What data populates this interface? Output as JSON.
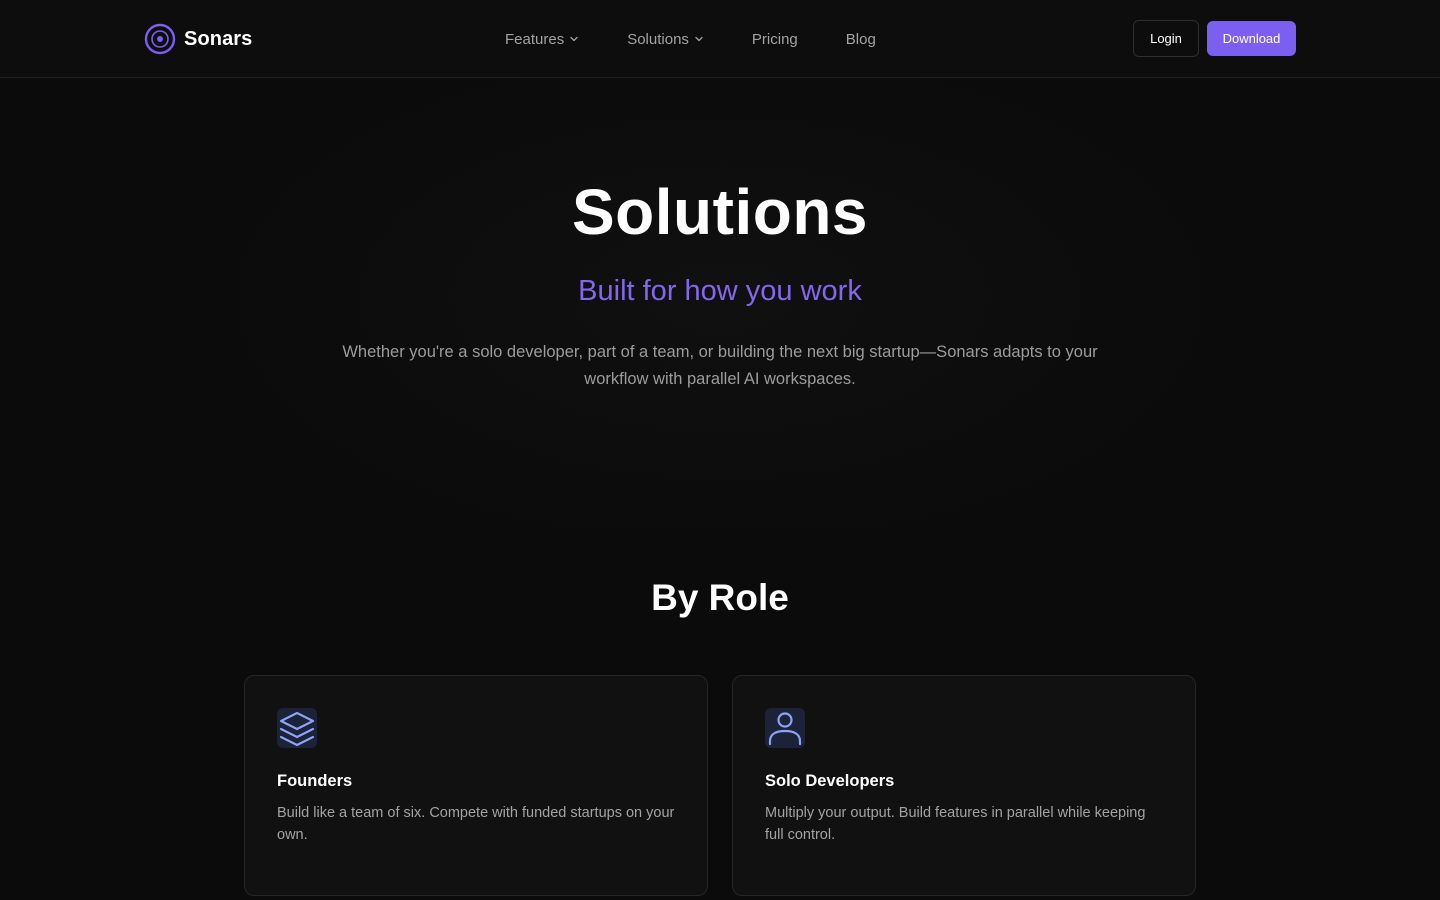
{
  "brand": {
    "name": "Sonars",
    "logo_icon": "sonar-target-icon",
    "accent_color": "#7b5ff0"
  },
  "nav": {
    "items": [
      {
        "label": "Features",
        "has_dropdown": true
      },
      {
        "label": "Solutions",
        "has_dropdown": true
      },
      {
        "label": "Pricing",
        "has_dropdown": false
      },
      {
        "label": "Blog",
        "has_dropdown": false
      }
    ],
    "login_label": "Login",
    "download_label": "Download"
  },
  "hero": {
    "title": "Solutions",
    "subtitle": "Built for how you work",
    "subtitle_color": "#8467ee",
    "description": "Whether you're a solo developer, part of a team, or building the next big startup—Sonars adapts to your workflow with parallel AI workspaces."
  },
  "roles": {
    "heading": "By Role",
    "cards": [
      {
        "icon": "layers-icon",
        "title": "Founders",
        "description": "Build like a team of six. Compete with funded startups on your own."
      },
      {
        "icon": "user-icon",
        "title": "Solo Developers",
        "description": "Multiply your output. Build features in parallel while keeping full control."
      }
    ]
  }
}
